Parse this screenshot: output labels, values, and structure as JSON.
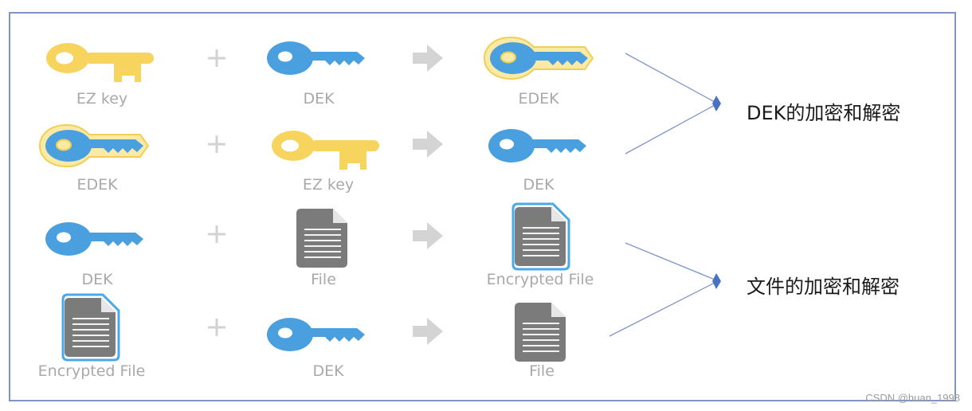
{
  "rows": [
    {
      "a": "EZ key",
      "b": "DEK",
      "c": "EDEK",
      "a_icon": "gold-key-icon",
      "b_icon": "blue-key-icon",
      "c_icon": "encrypted-key-icon"
    },
    {
      "a": "EDEK",
      "b": "EZ key",
      "c": "DEK",
      "a_icon": "encrypted-key-icon",
      "b_icon": "gold-key-icon",
      "c_icon": "blue-key-icon"
    },
    {
      "a": "DEK",
      "b": "File",
      "c": "Encrypted File",
      "a_icon": "blue-key-icon",
      "b_icon": "file-icon",
      "c_icon": "encrypted-file-icon"
    },
    {
      "a": "Encrypted File",
      "b": "DEK",
      "c": "File",
      "a_icon": "encrypted-file-icon",
      "b_icon": "blue-key-icon",
      "c_icon": "file-icon"
    }
  ],
  "groups": [
    {
      "label": "DEK的加密和解密"
    },
    {
      "label": "文件的加密和解密"
    }
  ],
  "watermark": "CSDN @huan_1998",
  "colors": {
    "gold": "#f6d45e",
    "blue": "#4a9fdf",
    "file": "#7b7b7b",
    "frame": "#7f95c9",
    "connector": "#7f95cc",
    "diamond": "#4a72c4",
    "operator": "#d0d0d0"
  }
}
